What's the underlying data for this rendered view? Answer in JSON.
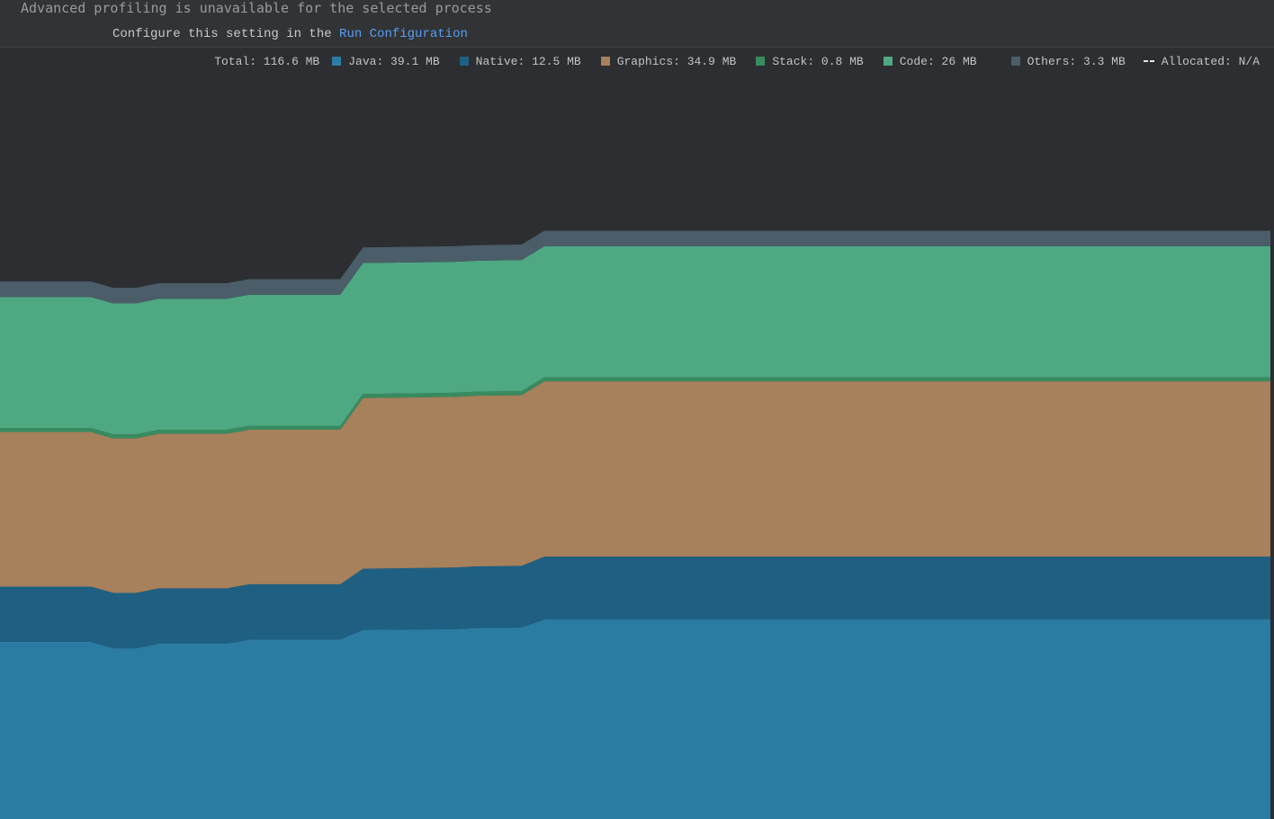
{
  "banner": {
    "message": "Advanced profiling is unavailable for the selected process",
    "hint_prefix": "Configure this setting in the ",
    "hint_link": "Run Configuration"
  },
  "legend": {
    "total": "Total: 116.6 MB",
    "items": [
      {
        "label": "Java: 39.1 MB",
        "color": "#2b7ca3"
      },
      {
        "label": "Native: 12.5 MB",
        "color": "#1f6082"
      },
      {
        "label": "Graphics: 34.9 MB",
        "color": "#a7805c"
      },
      {
        "label": "Stack: 0.8 MB",
        "color": "#388b5f"
      },
      {
        "label": "Code: 26 MB",
        "color": "#4ea882"
      },
      {
        "label": "Others: 3.3 MB",
        "color": "#4b5d69"
      }
    ],
    "allocated": "Allocated: N/A"
  },
  "chart_data": {
    "type": "area",
    "stacked": true,
    "x": [
      0,
      2,
      4,
      5,
      6,
      7,
      10,
      11,
      15,
      16,
      20,
      21,
      23,
      24,
      25,
      48,
      49,
      50,
      56
    ],
    "series": [
      {
        "name": "Java",
        "color": "#2b7ca3",
        "values": [
          30.7,
          30.7,
          30.7,
          29.6,
          29.6,
          30.4,
          30.4,
          31.1,
          31.1,
          32.8,
          32.9,
          33.1,
          33.2,
          34.6,
          34.6,
          34.6,
          34.6,
          34.6,
          34.6
        ]
      },
      {
        "name": "Native",
        "color": "#1f6082",
        "values": [
          9.6,
          9.6,
          9.6,
          9.6,
          9.6,
          9.6,
          9.6,
          9.6,
          9.6,
          10.6,
          10.7,
          10.7,
          10.7,
          10.9,
          10.9,
          10.9,
          10.9,
          10.9,
          10.9
        ]
      },
      {
        "name": "Graphics",
        "color": "#a7805c",
        "values": [
          26.8,
          26.8,
          26.8,
          26.8,
          26.8,
          26.8,
          26.8,
          26.8,
          26.8,
          29.6,
          29.6,
          29.6,
          29.6,
          30.4,
          30.4,
          30.4,
          30.4,
          30.4,
          30.4
        ]
      },
      {
        "name": "Stack",
        "color": "#388b5f",
        "values": [
          0.7,
          0.7,
          0.7,
          0.7,
          0.7,
          0.7,
          0.7,
          0.7,
          0.7,
          0.7,
          0.7,
          0.7,
          0.7,
          0.7,
          0.7,
          0.7,
          0.7,
          0.7,
          0.7
        ]
      },
      {
        "name": "Code",
        "color": "#4ea882",
        "values": [
          22.7,
          22.7,
          22.7,
          22.7,
          22.7,
          22.7,
          22.7,
          22.7,
          22.7,
          22.7,
          22.7,
          22.7,
          22.7,
          22.7,
          22.7,
          22.7,
          22.7,
          22.7,
          22.7
        ]
      },
      {
        "name": "Others",
        "color": "#4b5d69",
        "values": [
          2.7,
          2.7,
          2.7,
          2.7,
          2.7,
          2.7,
          2.7,
          2.7,
          2.7,
          2.7,
          2.7,
          2.7,
          2.7,
          2.7,
          2.7,
          2.7,
          2.7,
          2.7,
          2.7
        ]
      }
    ],
    "ylim": [
      0,
      142
    ],
    "grid": false,
    "legend_position": "top-right"
  }
}
